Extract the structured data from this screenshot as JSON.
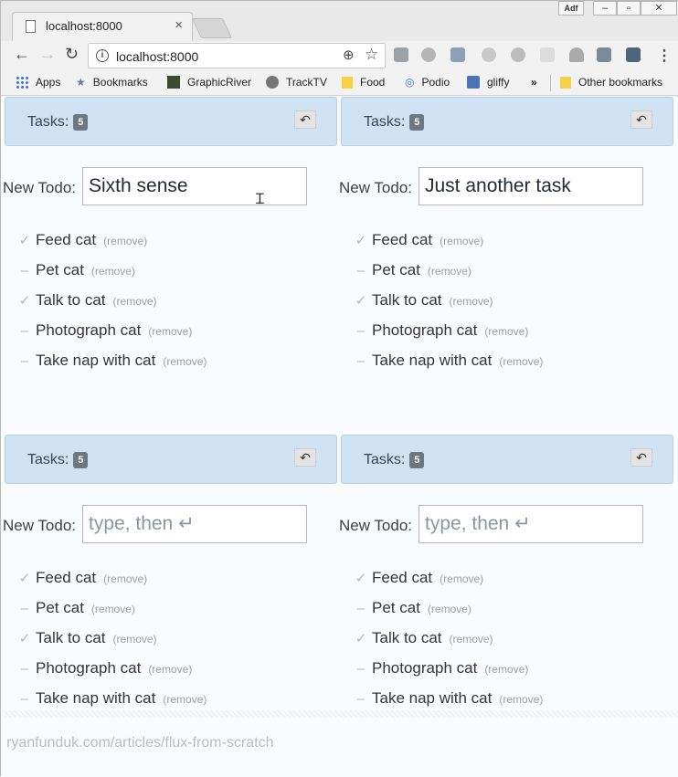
{
  "browser": {
    "tab_title": "localhost:8000",
    "url": "localhost:8000",
    "window_ad_label": "Adf",
    "bookmarks": {
      "apps": "Apps",
      "bookmarks": "Bookmarks",
      "graphicriver": "GraphicRiver",
      "tracktv": "TrackTV",
      "food": "Food",
      "podio": "Podio",
      "gliffy": "gliffy",
      "overflow": "»",
      "other": "Other bookmarks"
    }
  },
  "panels": [
    {
      "header": "Tasks:",
      "count": "5",
      "new_todo_label": "New Todo:",
      "input_value": "Sixth sense",
      "input_placeholder": "type, then ↵",
      "todos": [
        {
          "text": "Feed cat",
          "done": true,
          "mark": "✓",
          "remove": "(remove)"
        },
        {
          "text": "Pet cat",
          "done": false,
          "mark": "–",
          "remove": "(remove)"
        },
        {
          "text": "Talk to cat",
          "done": true,
          "mark": "✓",
          "remove": "(remove)"
        },
        {
          "text": "Photograph cat",
          "done": false,
          "mark": "–",
          "remove": "(remove)"
        },
        {
          "text": "Take nap with cat",
          "done": false,
          "mark": "–",
          "remove": "(remove)"
        }
      ]
    },
    {
      "header": "Tasks:",
      "count": "5",
      "new_todo_label": "New Todo:",
      "input_value": "Just another task",
      "input_placeholder": "type, then ↵",
      "todos": [
        {
          "text": "Feed cat",
          "done": true,
          "mark": "✓",
          "remove": "(remove)"
        },
        {
          "text": "Pet cat",
          "done": false,
          "mark": "–",
          "remove": "(remove)"
        },
        {
          "text": "Talk to cat",
          "done": true,
          "mark": "✓",
          "remove": "(remove)"
        },
        {
          "text": "Photograph cat",
          "done": false,
          "mark": "–",
          "remove": "(remove)"
        },
        {
          "text": "Take nap with cat",
          "done": false,
          "mark": "–",
          "remove": "(remove)"
        }
      ]
    },
    {
      "header": "Tasks:",
      "count": "5",
      "new_todo_label": "New Todo:",
      "input_value": "",
      "input_placeholder": "type, then ↵",
      "todos": [
        {
          "text": "Feed cat",
          "done": true,
          "mark": "✓",
          "remove": "(remove)"
        },
        {
          "text": "Pet cat",
          "done": false,
          "mark": "–",
          "remove": "(remove)"
        },
        {
          "text": "Talk to cat",
          "done": true,
          "mark": "✓",
          "remove": "(remove)"
        },
        {
          "text": "Photograph cat",
          "done": false,
          "mark": "–",
          "remove": "(remove)"
        },
        {
          "text": "Take nap with cat",
          "done": false,
          "mark": "–",
          "remove": "(remove)"
        }
      ]
    },
    {
      "header": "Tasks:",
      "count": "5",
      "new_todo_label": "New Todo:",
      "input_value": "",
      "input_placeholder": "type, then ↵",
      "todos": [
        {
          "text": "Feed cat",
          "done": true,
          "mark": "✓",
          "remove": "(remove)"
        },
        {
          "text": "Pet cat",
          "done": false,
          "mark": "–",
          "remove": "(remove)"
        },
        {
          "text": "Talk to cat",
          "done": true,
          "mark": "✓",
          "remove": "(remove)"
        },
        {
          "text": "Photograph cat",
          "done": false,
          "mark": "–",
          "remove": "(remove)"
        },
        {
          "text": "Take nap with cat",
          "done": false,
          "mark": "–",
          "remove": "(remove)"
        }
      ]
    }
  ],
  "footer": {
    "text": "ryanfunduk.com/articles/flux-from-scratch"
  },
  "icons": {
    "undo": "undo-icon",
    "done": "check-icon",
    "pending": "dash-icon"
  },
  "colors": {
    "header_bg": "#cfe3f4",
    "badge_bg": "#6d7781",
    "check": "#b5b5b5"
  }
}
